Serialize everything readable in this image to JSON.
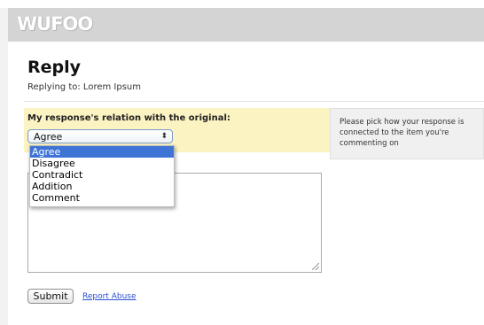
{
  "header": {
    "logo": "WUFOO"
  },
  "form": {
    "title": "Reply",
    "replying_to": "Replying to: Lorem Ipsum",
    "relation_label": "My response's relation with the original:",
    "selected_value": "Agree",
    "help_text": "Please pick how your response is connected to the item you're commenting on",
    "submit_label": "Submit",
    "report_label": "Report Abuse"
  },
  "dropdown": {
    "options": [
      "Agree",
      "Disagree",
      "Contradict",
      "Addition",
      "Comment"
    ],
    "selected_index": 0
  },
  "icons": {
    "select_arrow": "updown-arrow-icon",
    "resize_grip": "resize-grip-icon"
  },
  "colors": {
    "header_bg": "#d4d4d4",
    "field_highlight": "#fbf3c2",
    "selected_option": "#3e74d6",
    "link": "#2a4fd0"
  }
}
